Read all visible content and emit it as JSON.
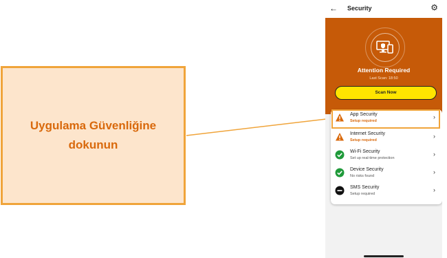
{
  "callout": {
    "line1": "Uygulama Güvenliğine",
    "line2": "dokunun"
  },
  "app": {
    "title": "Security",
    "icons": {
      "back": "arrow-left-icon",
      "settings": "gear-icon"
    },
    "hero": {
      "status": "Attention Required",
      "last_scan": "Last Scan: 18:50",
      "scan_button": "Scan Now"
    },
    "items": [
      {
        "label": "App Security",
        "status": "Setup required",
        "icon": "warning-icon",
        "state": "warning"
      },
      {
        "label": "Internet Security",
        "status": "Setup required",
        "icon": "warning-icon",
        "state": "warning"
      },
      {
        "label": "Wi-Fi Security",
        "status": "Set up real-time protection",
        "icon": "check-icon",
        "state": "ok"
      },
      {
        "label": "Device Security",
        "status": "No risks found",
        "icon": "check-icon",
        "state": "ok"
      },
      {
        "label": "SMS Security",
        "status": "Setup required",
        "icon": "disabled-icon",
        "state": "off"
      }
    ]
  },
  "colors": {
    "brand": "#c65a08",
    "accent": "#ffe500",
    "warning": "#d9690c",
    "ok": "#1f9a3a",
    "highlight": "#f0a43a"
  }
}
